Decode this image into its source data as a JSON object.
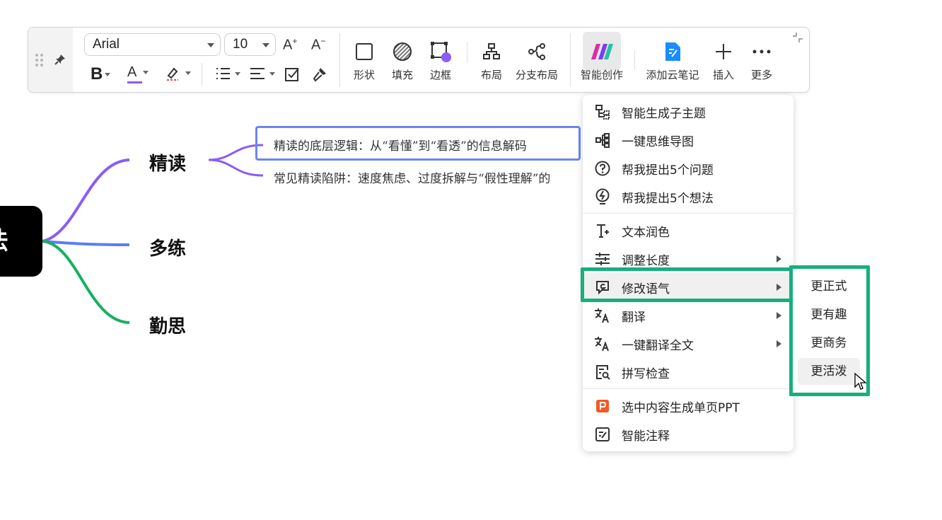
{
  "toolbar": {
    "font_family": "Arial",
    "font_size": "10",
    "items": {
      "shape": "形状",
      "fill": "填充",
      "border": "边框",
      "layout": "布局",
      "branch_layout": "分支布局",
      "ai_create": "智能创作",
      "add_cloud_note": "添加云笔记",
      "insert": "插入",
      "more": "更多"
    }
  },
  "mindmap": {
    "root": "法",
    "nodes": [
      "精读",
      "多练",
      "勤思"
    ],
    "leaves": [
      "精读的底层逻辑：从“看懂”到“看透”的信息解码",
      "常见精读陷阱：速度焦虑、过度拆解与“假性理解”的"
    ]
  },
  "menu": {
    "items": [
      {
        "label": "智能生成子主题",
        "icon": "subtopic-icon"
      },
      {
        "label": "一键思维导图",
        "icon": "mindmap-icon"
      },
      {
        "label": "帮我提出5个问题",
        "icon": "question-icon"
      },
      {
        "label": "帮我提出5个想法",
        "icon": "lightbulb-icon"
      },
      {
        "label": "文本润色",
        "icon": "text-polish-icon"
      },
      {
        "label": "调整长度",
        "icon": "adjust-length-icon"
      },
      {
        "label": "修改语气",
        "icon": "tone-icon"
      },
      {
        "label": "翻译",
        "icon": "translate-icon"
      },
      {
        "label": "一键翻译全文",
        "icon": "translate-all-icon"
      },
      {
        "label": "拼写检查",
        "icon": "spell-check-icon"
      },
      {
        "label": "选中内容生成单页PPT",
        "icon": "ppt-icon"
      },
      {
        "label": "智能注释",
        "icon": "annotation-icon"
      }
    ]
  },
  "submenu": {
    "items": [
      "更正式",
      "更有趣",
      "更商务",
      "更活泼"
    ]
  },
  "colors": {
    "purple_branch": "#8b5cf6",
    "blue_branch": "#5b7cf5",
    "green_branch": "#16b060",
    "highlight": "#16b07a",
    "selected_box": "#6b85f2",
    "ppt_orange": "#f05a24",
    "note_blue": "#1a8cff"
  }
}
